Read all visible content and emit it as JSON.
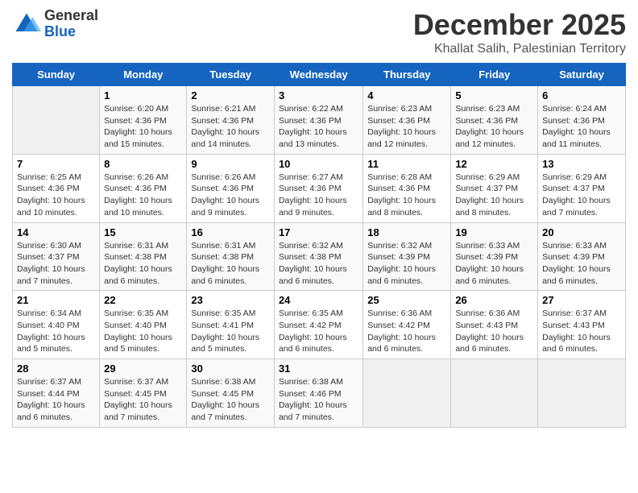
{
  "logo": {
    "general": "General",
    "blue": "Blue"
  },
  "title": "December 2025",
  "location": "Khallat Salih, Palestinian Territory",
  "days_of_week": [
    "Sunday",
    "Monday",
    "Tuesday",
    "Wednesday",
    "Thursday",
    "Friday",
    "Saturday"
  ],
  "weeks": [
    [
      {
        "day": "",
        "info": ""
      },
      {
        "day": "1",
        "info": "Sunrise: 6:20 AM\nSunset: 4:36 PM\nDaylight: 10 hours\nand 15 minutes."
      },
      {
        "day": "2",
        "info": "Sunrise: 6:21 AM\nSunset: 4:36 PM\nDaylight: 10 hours\nand 14 minutes."
      },
      {
        "day": "3",
        "info": "Sunrise: 6:22 AM\nSunset: 4:36 PM\nDaylight: 10 hours\nand 13 minutes."
      },
      {
        "day": "4",
        "info": "Sunrise: 6:23 AM\nSunset: 4:36 PM\nDaylight: 10 hours\nand 12 minutes."
      },
      {
        "day": "5",
        "info": "Sunrise: 6:23 AM\nSunset: 4:36 PM\nDaylight: 10 hours\nand 12 minutes."
      },
      {
        "day": "6",
        "info": "Sunrise: 6:24 AM\nSunset: 4:36 PM\nDaylight: 10 hours\nand 11 minutes."
      }
    ],
    [
      {
        "day": "7",
        "info": "Sunrise: 6:25 AM\nSunset: 4:36 PM\nDaylight: 10 hours\nand 10 minutes."
      },
      {
        "day": "8",
        "info": "Sunrise: 6:26 AM\nSunset: 4:36 PM\nDaylight: 10 hours\nand 10 minutes."
      },
      {
        "day": "9",
        "info": "Sunrise: 6:26 AM\nSunset: 4:36 PM\nDaylight: 10 hours\nand 9 minutes."
      },
      {
        "day": "10",
        "info": "Sunrise: 6:27 AM\nSunset: 4:36 PM\nDaylight: 10 hours\nand 9 minutes."
      },
      {
        "day": "11",
        "info": "Sunrise: 6:28 AM\nSunset: 4:36 PM\nDaylight: 10 hours\nand 8 minutes."
      },
      {
        "day": "12",
        "info": "Sunrise: 6:29 AM\nSunset: 4:37 PM\nDaylight: 10 hours\nand 8 minutes."
      },
      {
        "day": "13",
        "info": "Sunrise: 6:29 AM\nSunset: 4:37 PM\nDaylight: 10 hours\nand 7 minutes."
      }
    ],
    [
      {
        "day": "14",
        "info": "Sunrise: 6:30 AM\nSunset: 4:37 PM\nDaylight: 10 hours\nand 7 minutes."
      },
      {
        "day": "15",
        "info": "Sunrise: 6:31 AM\nSunset: 4:38 PM\nDaylight: 10 hours\nand 6 minutes."
      },
      {
        "day": "16",
        "info": "Sunrise: 6:31 AM\nSunset: 4:38 PM\nDaylight: 10 hours\nand 6 minutes."
      },
      {
        "day": "17",
        "info": "Sunrise: 6:32 AM\nSunset: 4:38 PM\nDaylight: 10 hours\nand 6 minutes."
      },
      {
        "day": "18",
        "info": "Sunrise: 6:32 AM\nSunset: 4:39 PM\nDaylight: 10 hours\nand 6 minutes."
      },
      {
        "day": "19",
        "info": "Sunrise: 6:33 AM\nSunset: 4:39 PM\nDaylight: 10 hours\nand 6 minutes."
      },
      {
        "day": "20",
        "info": "Sunrise: 6:33 AM\nSunset: 4:39 PM\nDaylight: 10 hours\nand 6 minutes."
      }
    ],
    [
      {
        "day": "21",
        "info": "Sunrise: 6:34 AM\nSunset: 4:40 PM\nDaylight: 10 hours\nand 5 minutes."
      },
      {
        "day": "22",
        "info": "Sunrise: 6:35 AM\nSunset: 4:40 PM\nDaylight: 10 hours\nand 5 minutes."
      },
      {
        "day": "23",
        "info": "Sunrise: 6:35 AM\nSunset: 4:41 PM\nDaylight: 10 hours\nand 5 minutes."
      },
      {
        "day": "24",
        "info": "Sunrise: 6:35 AM\nSunset: 4:42 PM\nDaylight: 10 hours\nand 6 minutes."
      },
      {
        "day": "25",
        "info": "Sunrise: 6:36 AM\nSunset: 4:42 PM\nDaylight: 10 hours\nand 6 minutes."
      },
      {
        "day": "26",
        "info": "Sunrise: 6:36 AM\nSunset: 4:43 PM\nDaylight: 10 hours\nand 6 minutes."
      },
      {
        "day": "27",
        "info": "Sunrise: 6:37 AM\nSunset: 4:43 PM\nDaylight: 10 hours\nand 6 minutes."
      }
    ],
    [
      {
        "day": "28",
        "info": "Sunrise: 6:37 AM\nSunset: 4:44 PM\nDaylight: 10 hours\nand 6 minutes."
      },
      {
        "day": "29",
        "info": "Sunrise: 6:37 AM\nSunset: 4:45 PM\nDaylight: 10 hours\nand 7 minutes."
      },
      {
        "day": "30",
        "info": "Sunrise: 6:38 AM\nSunset: 4:45 PM\nDaylight: 10 hours\nand 7 minutes."
      },
      {
        "day": "31",
        "info": "Sunrise: 6:38 AM\nSunset: 4:46 PM\nDaylight: 10 hours\nand 7 minutes."
      },
      {
        "day": "",
        "info": ""
      },
      {
        "day": "",
        "info": ""
      },
      {
        "day": "",
        "info": ""
      }
    ]
  ]
}
